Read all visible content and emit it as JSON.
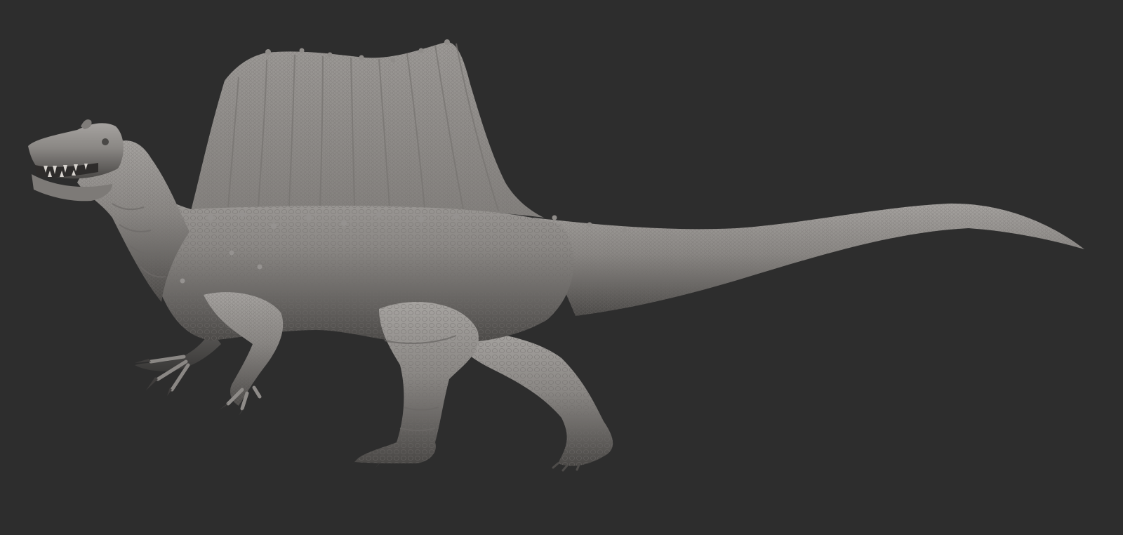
{
  "scene": {
    "subject": "spinosaurus-sculpt",
    "background_color": "#2d2d2d",
    "clay_color": "#858280",
    "clay_highlight": "#a7a4a1",
    "clay_shadow": "#3d3b3a"
  }
}
